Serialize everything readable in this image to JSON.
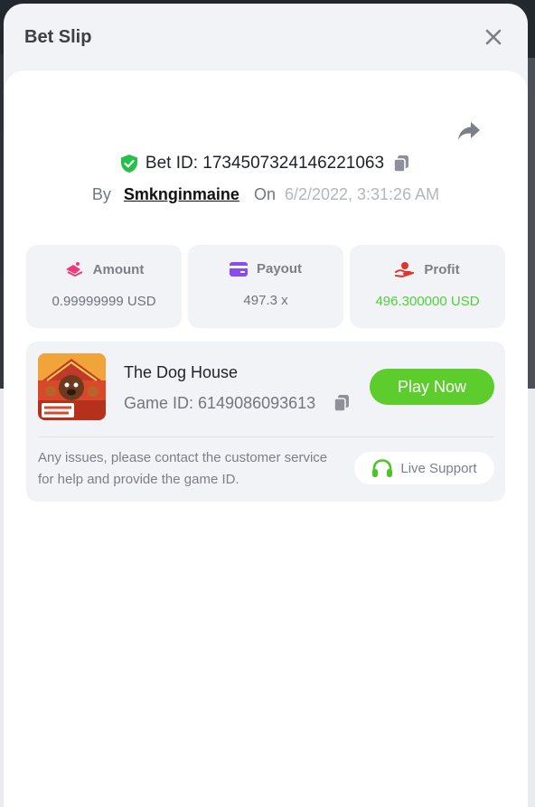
{
  "modal": {
    "title": "Bet Slip"
  },
  "bet": {
    "id_text": "Bet ID: 1734507324146221063",
    "by_label": "By",
    "username": "Smknginmaine",
    "on_label": "On",
    "date": "6/2/2022, 3:31:26 AM"
  },
  "stats": [
    {
      "label": "Amount",
      "value": "0.99999999 USD",
      "icon": "amount-icon"
    },
    {
      "label": "Payout",
      "value": "497.3 x",
      "icon": "card-icon"
    },
    {
      "label": "Profit",
      "value": "496.300000 USD",
      "icon": "hand-coin-icon"
    }
  ],
  "game": {
    "name": "The Dog House",
    "id_text": "Game ID: 6149086093613",
    "play_label": "Play Now",
    "thumb_text": "THE DOG HOUSE"
  },
  "support": {
    "help_text": "Any issues, please contact the customer service for help and provide the game ID.",
    "live_label": "Live Support"
  },
  "colors": {
    "accent_green": "#5ccd2d",
    "profit_green": "#4fd13a",
    "amount_pink": "#ef3a7a",
    "payout_purple": "#8a4cf0",
    "profit_red": "#e5312b"
  }
}
